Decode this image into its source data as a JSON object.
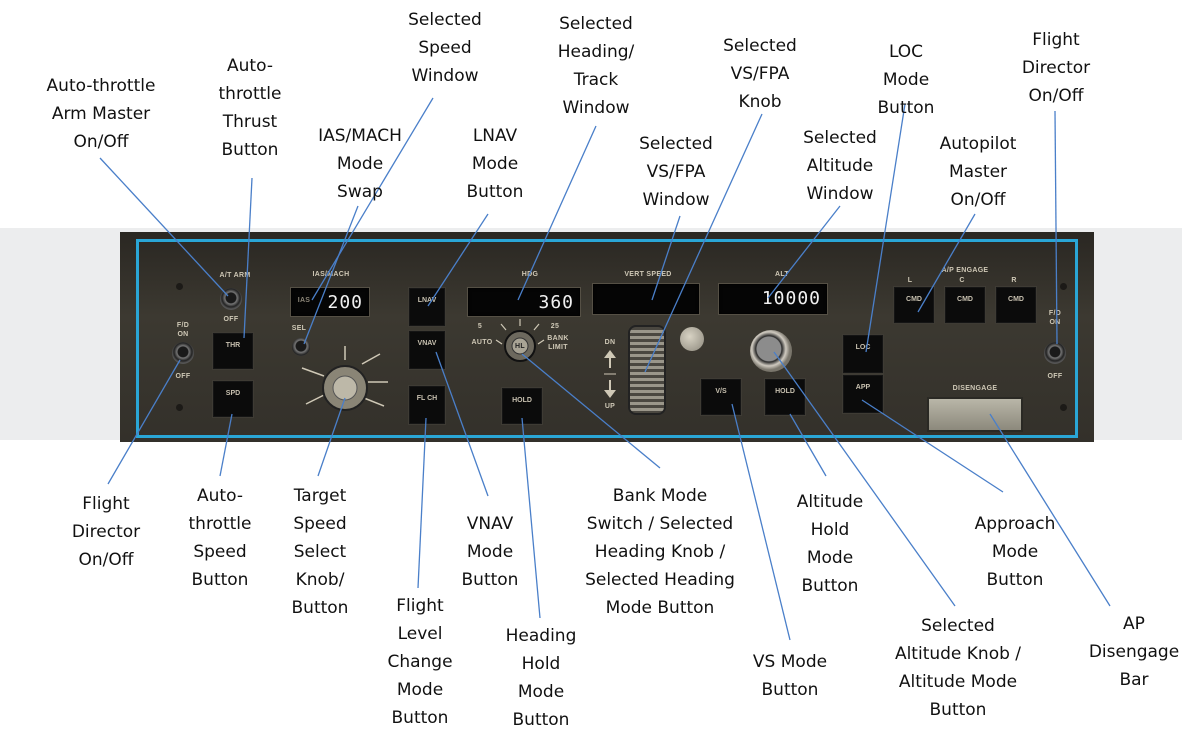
{
  "panel": {
    "labels": {
      "at_arm": "A/T ARM",
      "ias_mach": "IAS/MACH",
      "hdg": "HDG",
      "vert_speed": "VERT SPEED",
      "alt": "ALT",
      "ap_engage": "A/P ENGAGE",
      "ap_l": "L",
      "ap_c": "C",
      "ap_r": "R",
      "fd_on_left": "F/D\nON",
      "fd_off_left": "OFF",
      "fd_on_right": "F/D\nON",
      "fd_off_right": "OFF",
      "at_off": "OFF",
      "sel": "SEL",
      "ias_tag": "IAS",
      "bank_5": "5",
      "bank_25": "25",
      "bank_auto": "AUTO",
      "bank_limit": "BANK\nLIMIT",
      "bank_center": "HL",
      "dn": "DN",
      "up": "UP",
      "disengage": "DISENGAGE"
    },
    "buttons": {
      "thr": "THR",
      "spd": "SPD",
      "lnav": "LNAV",
      "vnav": "VNAV",
      "flch": "FL CH",
      "hdg_hold": "HOLD",
      "vs": "V/S",
      "alt_hold": "HOLD",
      "loc": "LOC",
      "app": "APP",
      "cmd_l": "CMD",
      "cmd_c": "CMD",
      "cmd_r": "CMD"
    },
    "displays": {
      "speed": "200",
      "heading": "360",
      "vs": "",
      "altitude": "10000"
    }
  },
  "annotations": {
    "auto_throttle_arm": "Auto-throttle\nArm Master\nOn/Off",
    "auto_throttle_thrust": "Auto-\nthrottle\nThrust\nButton",
    "ias_mach_swap": "IAS/MACH\nMode\nSwap",
    "selected_speed_window": "Selected\nSpeed\nWindow",
    "lnav_button": "LNAV\nMode\nButton",
    "selected_heading_window": "Selected\nHeading/\nTrack\nWindow",
    "selected_vs_window": "Selected\nVS/FPA\nWindow",
    "selected_vs_knob": "Selected\nVS/FPA\nKnob",
    "selected_altitude_window": "Selected\nAltitude\nWindow",
    "loc_button": "LOC\nMode\nButton",
    "autopilot_master": "Autopilot\nMaster\nOn/Off",
    "flight_director_right": "Flight\nDirector\nOn/Off",
    "flight_director_left": "Flight\nDirector\nOn/Off",
    "auto_throttle_speed": "Auto-\nthrottle\nSpeed\nButton",
    "target_speed_knob": "Target\nSpeed\nSelect\nKnob/\nButton",
    "flch_button": "Flight\nLevel\nChange\nMode\nButton",
    "vnav_button": "VNAV\nMode\nButton",
    "heading_hold_button": "Heading\nHold\nMode\nButton",
    "bank_mode_switch": "Bank Mode\nSwitch / Selected\nHeading Knob /\nSelected Heading\nMode Button",
    "vs_mode_button": "VS Mode\nButton",
    "altitude_hold_button": "Altitude\nHold\nMode\nButton",
    "selected_altitude_knob": "Selected\nAltitude Knob /\nAltitude Mode\nButton",
    "approach_button": "Approach\nMode\nButton",
    "ap_disengage_bar": "AP\nDisengage\nBar"
  },
  "colors": {
    "leader_line": "#4a7fc9",
    "frame": "#2aa6d6",
    "panel": "#37342d"
  }
}
